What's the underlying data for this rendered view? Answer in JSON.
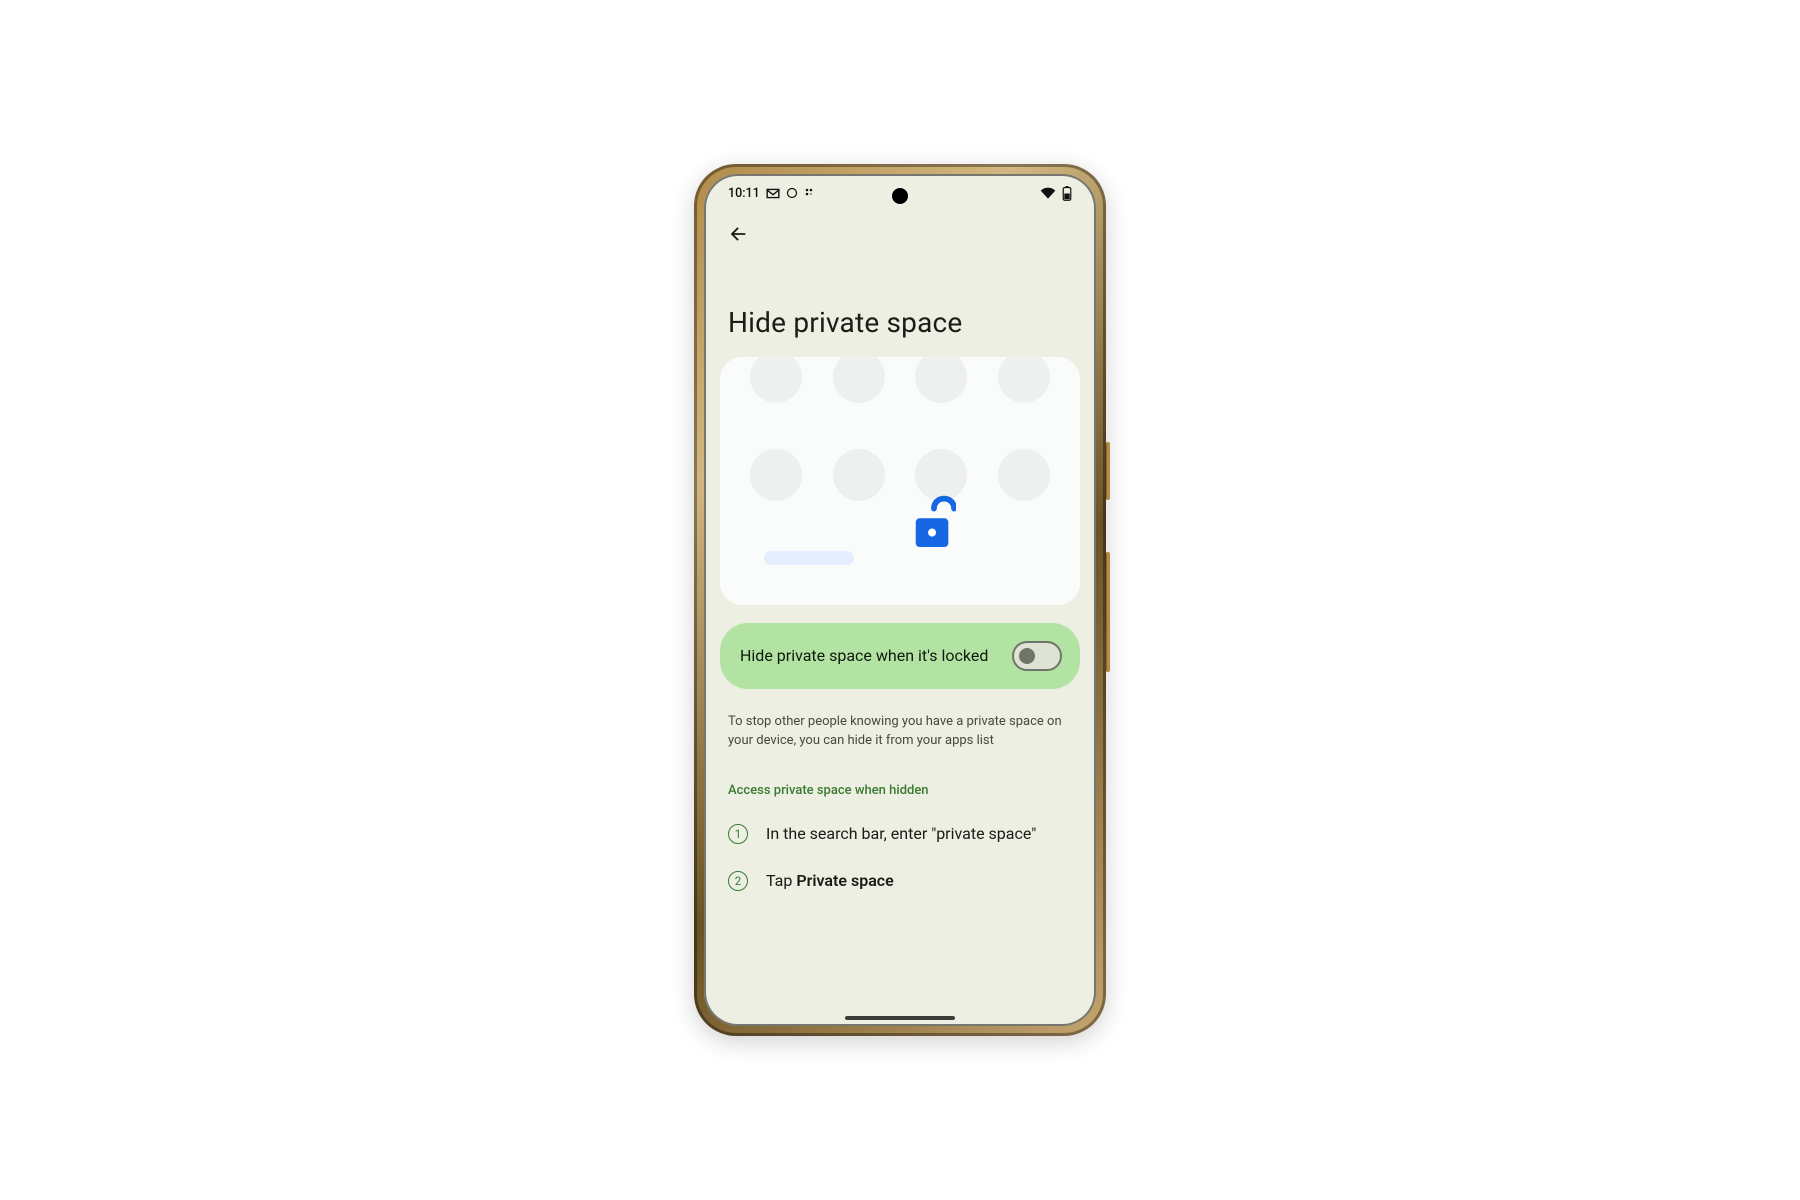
{
  "status": {
    "time": "10:11",
    "left_icons": [
      "gmail-icon",
      "circle-icon",
      "dots-icon"
    ],
    "right_icons": [
      "wifi-icon",
      "battery-icon"
    ]
  },
  "page": {
    "title": "Hide private space",
    "toggle_label": "Hide private space when it's locked",
    "toggle_on": false,
    "description": "To stop other people knowing you have a private space on your device, you can hide it from your apps list",
    "section_header": "Access private space when hidden",
    "steps": [
      {
        "num": "1",
        "text_prefix": "In the search bar, enter \"private space\"",
        "text_bold": ""
      },
      {
        "num": "2",
        "text_prefix": "Tap ",
        "text_bold": "Private space"
      }
    ]
  }
}
